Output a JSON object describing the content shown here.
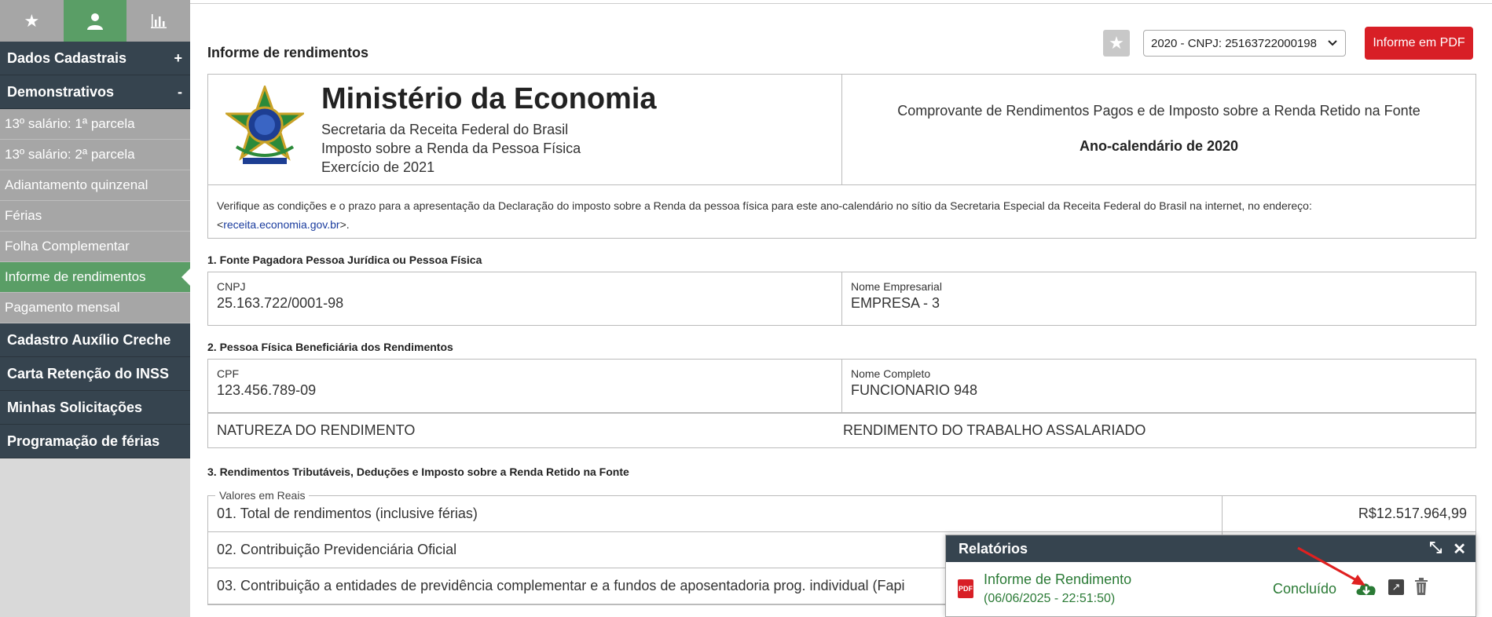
{
  "sidebar": {
    "tabs": [
      {
        "icon": "star-icon",
        "glyph": "★"
      },
      {
        "icon": "user-icon",
        "glyph": "👤"
      },
      {
        "icon": "bar-chart-icon",
        "glyph": "📊"
      }
    ],
    "sections": {
      "dados": {
        "label": "Dados Cadastrais",
        "toggle": "+"
      },
      "demonstrativos": {
        "label": "Demonstrativos",
        "toggle": "-"
      }
    },
    "items": [
      "13º salário: 1ª parcela",
      "13º salário: 2ª parcela",
      "Adiantamento quinzenal",
      "Férias",
      "Folha Complementar",
      "Informe de rendimentos",
      "Pagamento mensal"
    ],
    "bottom_sections": [
      "Cadastro Auxílio Creche",
      "Carta Retenção do INSS",
      "Minhas Solicitações",
      "Programação de férias"
    ]
  },
  "header": {
    "title": "Informe de rendimentos",
    "select_value": "2020 - CNPJ: 25163722000198",
    "pdf_button": "Informe em PDF"
  },
  "form": {
    "ministry": "Ministério da Economia",
    "lines": [
      "Secretaria da Receita Federal do Brasil",
      "Imposto sobre a Renda da Pessoa Física",
      "Exercício de 2021"
    ],
    "doc_title": "Comprovante de Rendimentos Pagos e de Imposto sobre a Renda Retido na Fonte",
    "ano": "Ano-calendário de 2020",
    "notice": "Verifique as condições e o prazo para a apresentação da Declaração do imposto sobre a Renda da pessoa física para este ano-calendário no sítio da Secretaria Especial da Receita Federal do Brasil na internet, no endereço:",
    "notice_link": "receita.economia.gov.br",
    "section1": "1. Fonte Pagadora Pessoa Jurídica ou Pessoa Física",
    "cnpj_label": "CNPJ",
    "cnpj_value": "25.163.722/0001-98",
    "empresa_label": "Nome Empresarial",
    "empresa_value": "EMPRESA - 3",
    "section2": "2. Pessoa Física Beneficiária dos Rendimentos",
    "cpf_label": "CPF",
    "cpf_value": "123.456.789-09",
    "nome_label": "Nome Completo",
    "nome_value": "FUNCIONARIO 948",
    "natureza_label": "NATUREZA DO RENDIMENTO",
    "natureza_value": "RENDIMENTO DO TRABALHO ASSALARIADO",
    "section3": "3. Rendimentos Tributáveis, Deduções e Imposto sobre a Renda Retido na Fonte",
    "legend": "Valores em Reais",
    "rows": [
      {
        "label": "01. Total de rendimentos (inclusive férias)",
        "value": "R$12.517.964,99"
      },
      {
        "label": "02. Contribuição Previdenciária Oficial",
        "value": ""
      },
      {
        "label": "03. Contribuição a entidades de previdência complementar e a fundos de aposentadoria prog. individual (Fapi",
        "value": ""
      }
    ]
  },
  "reports": {
    "title": "Relatórios",
    "name": "Informe de Rendimento",
    "date": "(06/06/2025 - 22:51:50)",
    "status": "Concluído"
  }
}
